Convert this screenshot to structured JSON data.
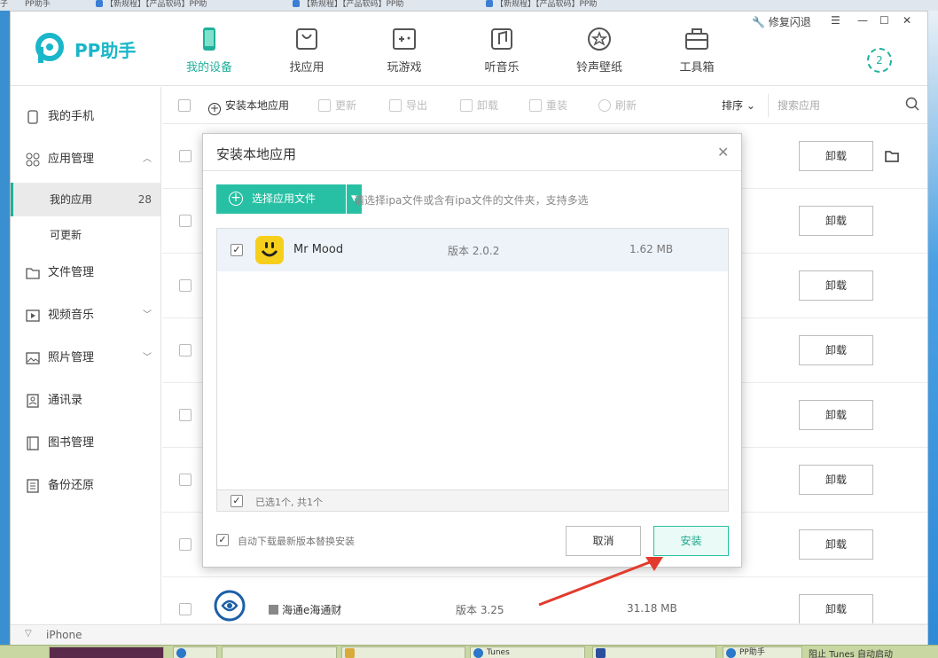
{
  "bg_tabs": [
    "子",
    "PP助手",
    "【新规程】【产品软码】PP助",
    "【新规程】【产品软码】PP助",
    "【新规程】【产品软码】PP助"
  ],
  "app": {
    "logo_text": "PP助手",
    "repair_label": "修复闪退",
    "download_count": "2",
    "nav": [
      {
        "label": "我的设备",
        "icon": "phone-icon",
        "active": true
      },
      {
        "label": "找应用",
        "icon": "bag-icon"
      },
      {
        "label": "玩游戏",
        "icon": "gamepad-icon"
      },
      {
        "label": "听音乐",
        "icon": "music-icon"
      },
      {
        "label": "铃声壁纸",
        "icon": "star-icon"
      },
      {
        "label": "工具箱",
        "icon": "toolbox-icon"
      }
    ]
  },
  "sidebar": {
    "items": [
      {
        "label": "我的手机",
        "icon": "phone-icon"
      },
      {
        "label": "应用管理",
        "icon": "apps-icon",
        "chevron": "^"
      },
      {
        "label": "文件管理",
        "icon": "folder-icon"
      },
      {
        "label": "视频音乐",
        "icon": "video-icon",
        "chevron": "v"
      },
      {
        "label": "照片管理",
        "icon": "photo-icon",
        "chevron": "v"
      },
      {
        "label": "通讯录",
        "icon": "contacts-icon"
      },
      {
        "label": "图书管理",
        "icon": "book-icon"
      },
      {
        "label": "备份还原",
        "icon": "backup-icon"
      }
    ],
    "subitems": [
      {
        "label": "我的应用",
        "count": "28",
        "active": true
      },
      {
        "label": "可更新"
      }
    ]
  },
  "toolbar": {
    "install_local": "安装本地应用",
    "update": "更新",
    "export": "导出",
    "uninstall": "卸载",
    "reinstall": "重装",
    "refresh": "刷新",
    "sort": "排序",
    "search_placeholder": "搜索应用"
  },
  "rows": {
    "uninstall_label": "卸载",
    "last_app": {
      "name": "海通e海通财",
      "version": "版本 3.25",
      "size": "31.18 MB"
    }
  },
  "footer": {
    "device": "iPhone"
  },
  "modal": {
    "title": "安装本地应用",
    "pick_button": "选择应用文件",
    "hint": "请选择ipa文件或含有ipa文件的文件夹，支持多选",
    "list": [
      {
        "name": "Mr Mood",
        "version": "版本 2.0.2",
        "size": "1.62 MB",
        "checked": true
      }
    ],
    "selected_summary": "已选1个, 共1个",
    "auto_update_label": "自动下载最新版本替换安装",
    "cancel": "取消",
    "install": "安装"
  },
  "taskbar": {
    "items": [
      "",
      "Tunes",
      "PP助手"
    ],
    "right_text": "阻止 Tunes 自动启动"
  },
  "colors": {
    "accent": "#1fb09b",
    "primary_btn": "#28c0a4",
    "app_icon_bg": "#f6cf1c",
    "arrow": "#e23b2e"
  }
}
